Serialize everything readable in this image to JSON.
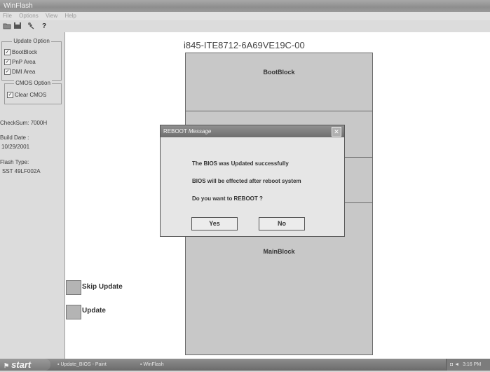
{
  "window": {
    "title": "WinFlash"
  },
  "menu": {
    "items": [
      "File",
      "Options",
      "View",
      "Help"
    ]
  },
  "toolbar": {
    "icons": [
      "open-icon",
      "save-icon",
      "flash-icon",
      "help-icon"
    ],
    "help_glyph": "?"
  },
  "sidebar": {
    "update_option": {
      "title": "Update Option",
      "items": [
        {
          "label": "BootBlock",
          "checked": true
        },
        {
          "label": "PnP Area",
          "checked": true
        },
        {
          "label": "DMI Area",
          "checked": true
        }
      ]
    },
    "cmos_option": {
      "title": "CMOS Option",
      "items": [
        {
          "label": "Clear CMOS",
          "checked": true
        }
      ]
    },
    "checksum": "CheckSum: 7000H",
    "build_date_label": "Build Date :",
    "build_date": "10/29/2001",
    "flash_type_label": "Flash Type:",
    "flash_type": "SST 49LF002A"
  },
  "main": {
    "device_title": "i845-ITE8712-6A69VE19C-00",
    "blocks": {
      "bootblock": "BootBlock",
      "mainblock": "MainBlock"
    },
    "legend": {
      "skip": "Skip Update",
      "update": "Update"
    }
  },
  "dialog": {
    "title_a": "REBOOT",
    "title_b": "Message",
    "close_glyph": "✕",
    "line1": "The BIOS was Updated successfully",
    "line2": "BIOS will be effected after reboot system",
    "line3": "Do you want to REBOOT ?",
    "yes": "Yes",
    "no": "No"
  },
  "taskbar": {
    "start": "start",
    "tasks": [
      "Update_BIOS - Paint",
      "WinFlash"
    ],
    "clock": "3:16 PM"
  },
  "colors": {
    "chrome": "#dcdcdc",
    "block_fill": "#c8c8c8",
    "dialog_bg": "#e6e6e6",
    "titlebar": "#8e8e8e"
  }
}
